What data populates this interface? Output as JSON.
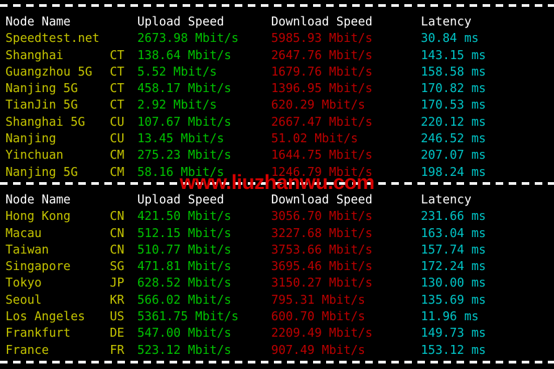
{
  "terminal": {
    "background": "#000000",
    "colors": {
      "header": "#ffffff",
      "node_name": "#c4c400",
      "isp": "#c4c400",
      "upload": "#00c200",
      "download": "#bb0000",
      "latency": "#00c5c7",
      "watermark": "#d40000",
      "divider": "#f2f2f2"
    }
  },
  "watermark": {
    "text": "www.liuzhanwu.com"
  },
  "columns": {
    "node_name": "Node Name",
    "isp": "",
    "upload_speed": "Upload Speed",
    "download_speed": "Download Speed",
    "latency": "Latency"
  },
  "tables": [
    {
      "id": "domestic-speedtest",
      "header": {
        "node_name": "Node Name",
        "isp": "",
        "upload_speed": "Upload Speed",
        "download_speed": "Download Speed",
        "latency": "Latency"
      },
      "rows": [
        {
          "node": "Speedtest.net",
          "isp": "",
          "upload": "2673.98 Mbit/s",
          "download": "5985.93 Mbit/s",
          "latency": "30.84 ms"
        },
        {
          "node": "Shanghai",
          "isp": "CT",
          "upload": "138.64 Mbit/s",
          "download": "2647.76 Mbit/s",
          "latency": "143.15 ms"
        },
        {
          "node": "Guangzhou 5G",
          "isp": "CT",
          "upload": "5.52 Mbit/s",
          "download": "1679.76 Mbit/s",
          "latency": "158.58 ms"
        },
        {
          "node": "Nanjing 5G",
          "isp": "CT",
          "upload": "458.17 Mbit/s",
          "download": "1396.95 Mbit/s",
          "latency": "170.82 ms"
        },
        {
          "node": "TianJin 5G",
          "isp": "CT",
          "upload": "2.92 Mbit/s",
          "download": "620.29 Mbit/s",
          "latency": "170.53 ms"
        },
        {
          "node": "Shanghai 5G",
          "isp": "CU",
          "upload": "107.67 Mbit/s",
          "download": "2667.47 Mbit/s",
          "latency": "220.12 ms"
        },
        {
          "node": "Nanjing",
          "isp": "CU",
          "upload": "13.45 Mbit/s",
          "download": "51.02 Mbit/s",
          "latency": "246.52 ms"
        },
        {
          "node": "Yinchuan",
          "isp": "CM",
          "upload": "275.23 Mbit/s",
          "download": "1644.75 Mbit/s",
          "latency": "207.07 ms"
        },
        {
          "node": "Nanjing 5G",
          "isp": "CM",
          "upload": "58.16 Mbit/s",
          "download": "1246.79 Mbit/s",
          "latency": "198.24 ms"
        }
      ]
    },
    {
      "id": "international-speedtest",
      "header": {
        "node_name": "Node Name",
        "isp": "",
        "upload_speed": "Upload Speed",
        "download_speed": "Download Speed",
        "latency": "Latency"
      },
      "rows": [
        {
          "node": "Hong Kong",
          "isp": "CN",
          "upload": "421.50 Mbit/s",
          "download": "3056.70 Mbit/s",
          "latency": "231.66 ms"
        },
        {
          "node": "Macau",
          "isp": "CN",
          "upload": "512.15 Mbit/s",
          "download": "3227.68 Mbit/s",
          "latency": "163.04 ms"
        },
        {
          "node": "Taiwan",
          "isp": "CN",
          "upload": "510.77 Mbit/s",
          "download": "3753.66 Mbit/s",
          "latency": "157.74 ms"
        },
        {
          "node": "Singapore",
          "isp": "SG",
          "upload": "471.81 Mbit/s",
          "download": "3695.46 Mbit/s",
          "latency": "172.24 ms"
        },
        {
          "node": "Tokyo",
          "isp": "JP",
          "upload": "628.52 Mbit/s",
          "download": "3150.27 Mbit/s",
          "latency": "130.00 ms"
        },
        {
          "node": "Seoul",
          "isp": "KR",
          "upload": "566.02 Mbit/s",
          "download": "795.31 Mbit/s",
          "latency": "135.69 ms"
        },
        {
          "node": "Los Angeles",
          "isp": "US",
          "upload": "5361.75 Mbit/s",
          "download": "600.70 Mbit/s",
          "latency": "11.96 ms"
        },
        {
          "node": "Frankfurt",
          "isp": "DE",
          "upload": "547.00 Mbit/s",
          "download": "2209.49 Mbit/s",
          "latency": "149.73 ms"
        },
        {
          "node": "France",
          "isp": "FR",
          "upload": "523.12 Mbit/s",
          "download": "907.49 Mbit/s",
          "latency": "153.12 ms"
        }
      ]
    }
  ]
}
